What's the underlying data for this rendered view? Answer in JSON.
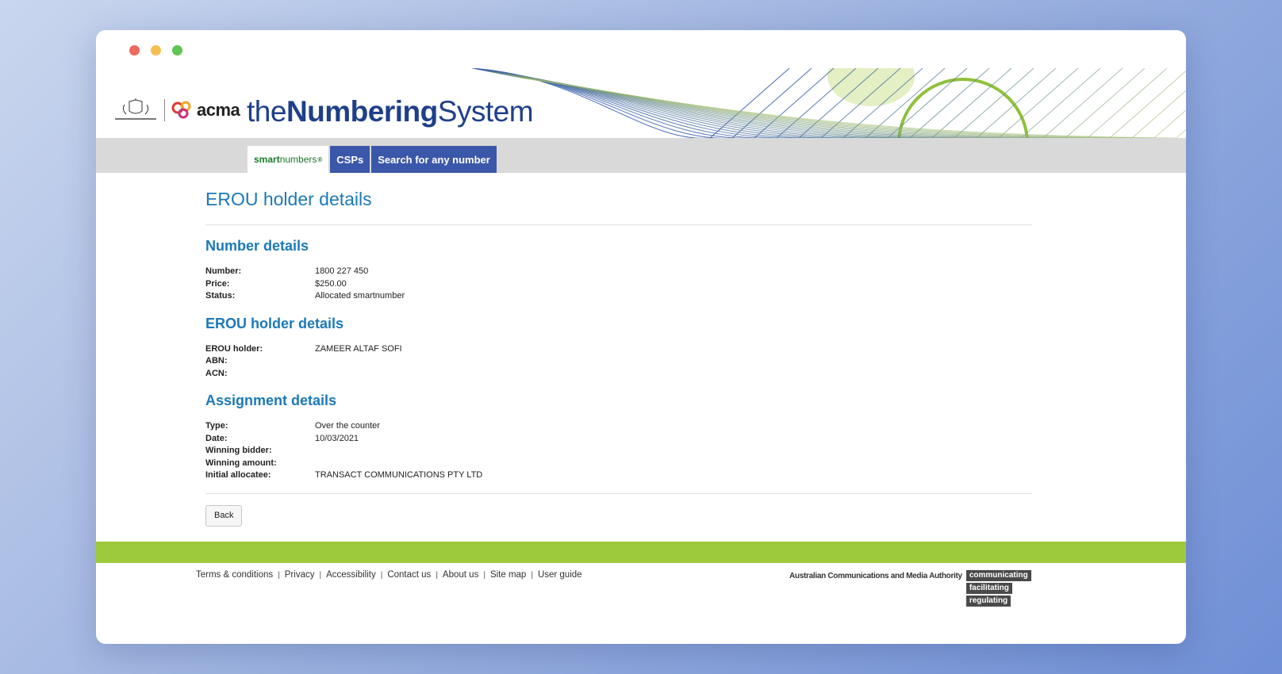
{
  "site": {
    "title_thin_prefix": "the",
    "title_bold": "Numbering",
    "title_thin_suffix": "System",
    "acma_logo_text": "acma"
  },
  "nav": {
    "tabs": [
      {
        "label_bold": "smart",
        "label_thin": "numbers",
        "mark": "®"
      },
      {
        "label": "CSPs"
      },
      {
        "label": "Search for any number"
      }
    ]
  },
  "page": {
    "title": "EROU holder details"
  },
  "number_details": {
    "heading": "Number details",
    "rows": [
      {
        "label": "Number:",
        "value": "1800 227 450"
      },
      {
        "label": "Price:",
        "value": "$250.00"
      },
      {
        "label": "Status:",
        "value": "Allocated smartnumber"
      }
    ]
  },
  "holder_details": {
    "heading": "EROU holder details",
    "rows": [
      {
        "label": "EROU holder:",
        "value": "ZAMEER ALTAF SOFI"
      },
      {
        "label": "ABN:",
        "value": ""
      },
      {
        "label": "ACN:",
        "value": ""
      }
    ]
  },
  "assignment_details": {
    "heading": "Assignment details",
    "rows": [
      {
        "label": "Type:",
        "value": "Over the counter"
      },
      {
        "label": "Date:",
        "value": "10/03/2021"
      },
      {
        "label": "Winning bidder:",
        "value": ""
      },
      {
        "label": "Winning amount:",
        "value": ""
      },
      {
        "label": "Initial allocatee:",
        "value": "TRANSACT COMMUNICATIONS PTY LTD"
      }
    ]
  },
  "back_label": "Back",
  "footer": {
    "links": [
      "Terms & conditions",
      "Privacy",
      "Accessibility",
      "Contact us",
      "About us",
      "Site map",
      "User guide"
    ],
    "separator": "|",
    "authority": "Australian Communications and Media Authority",
    "tags": [
      "communicating",
      "facilitating",
      "regulating"
    ]
  },
  "colors": {
    "title_blue": "#1e3f8a",
    "heading_blue": "#1c79b8",
    "tab_blue": "#3a57a9",
    "green_bar": "#9dc93c",
    "smart_green": "#1a7a2a"
  },
  "icons": [
    "coat-of-arms-icon",
    "acma-logo-icon",
    "wave-banner-graphic"
  ]
}
